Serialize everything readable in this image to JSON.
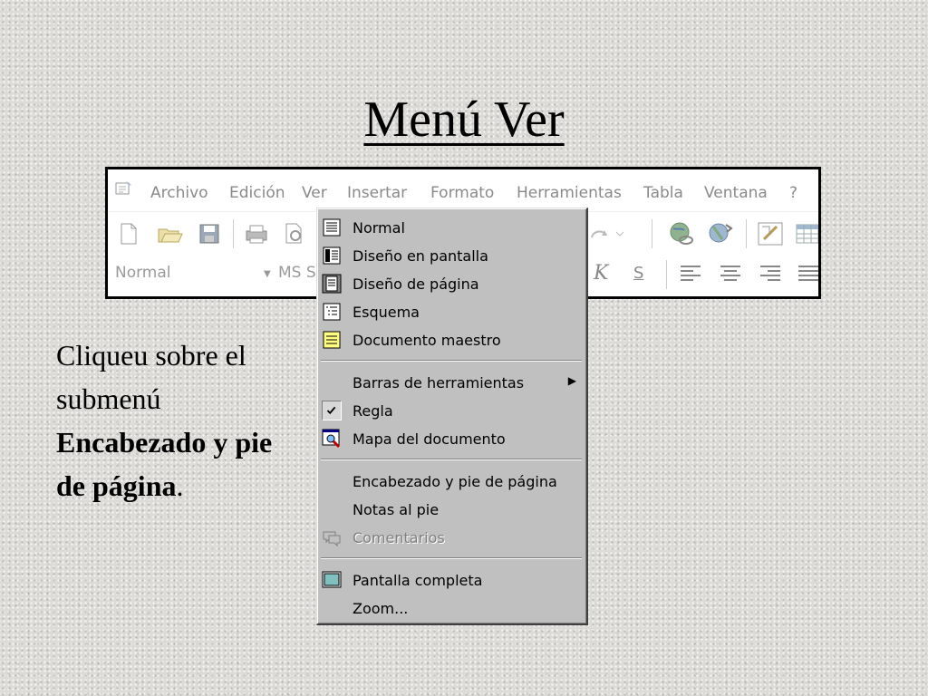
{
  "slide": {
    "title": "Menú Ver",
    "instruction_plain": "Cliqueu sobre el submenú ",
    "instruction_bold": "Encabezado y pie de página",
    "instruction_end": "."
  },
  "menubar": {
    "items": [
      "Archivo",
      "Edición",
      "Ver",
      "Insertar",
      "Formato",
      "Herramientas",
      "Tabla",
      "Ventana",
      "?"
    ]
  },
  "toolbar": {
    "style_value": "Normal",
    "font_value": "MS S",
    "italic_label": "K",
    "strike_label": "S"
  },
  "menu": {
    "items": [
      {
        "label": "Normal",
        "icon": "normal-view-icon"
      },
      {
        "label": "Diseño en pantalla",
        "icon": "online-layout-icon"
      },
      {
        "label": "Diseño de página",
        "icon": "page-layout-icon"
      },
      {
        "label": "Esquema",
        "icon": "outline-icon"
      },
      {
        "label": "Documento maestro",
        "icon": "master-document-icon"
      },
      {
        "label": "Barras de herramientas",
        "icon": "",
        "submenu": true
      },
      {
        "label": "Regla",
        "icon": "checkmark-icon",
        "checked": true
      },
      {
        "label": "Mapa del documento",
        "icon": "document-map-icon"
      },
      {
        "label": "Encabezado y pie de página",
        "icon": ""
      },
      {
        "label": "Notas al pie",
        "icon": ""
      },
      {
        "label": "Comentarios",
        "icon": "comments-icon",
        "disabled": true
      },
      {
        "label": "Pantalla completa",
        "icon": "full-screen-icon"
      },
      {
        "label": "Zoom...",
        "icon": ""
      }
    ]
  },
  "colors": {
    "menu_bg": "#c0c0c0",
    "disabled_text": "#808080",
    "slide_bg": "#dcdbd8"
  }
}
